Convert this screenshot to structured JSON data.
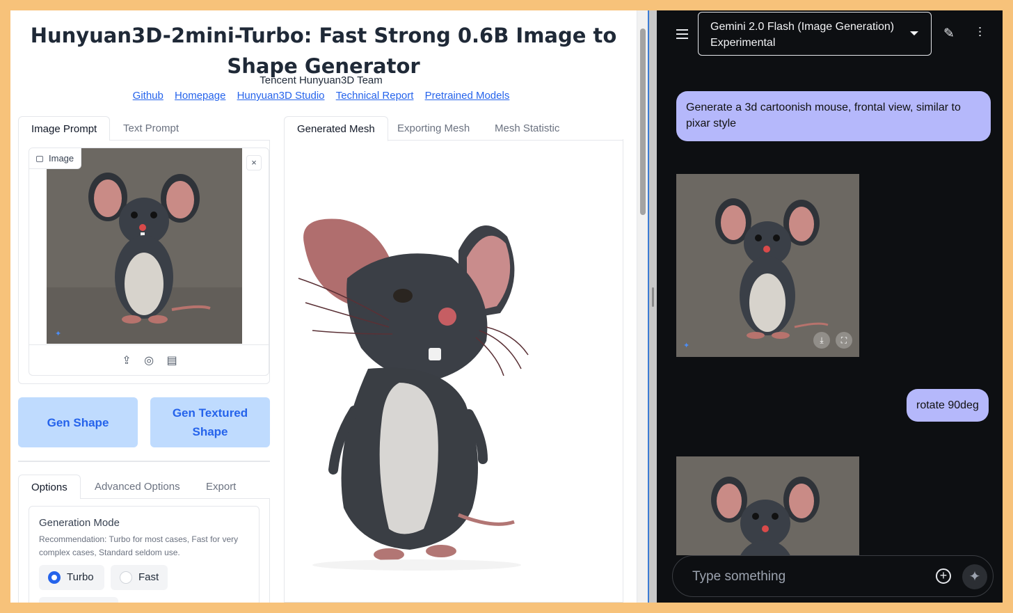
{
  "app": {
    "title": "Hunyuan3D-2mini-Turbo: Fast Strong 0.6B Image to Shape Generator",
    "team": "Tencent Hunyuan3D Team",
    "links": [
      "Github",
      "Homepage",
      "Hunyuan3D Studio",
      "Technical Report",
      "Pretrained Models"
    ]
  },
  "prompt_tabs": [
    "Image Prompt",
    "Text Prompt"
  ],
  "image_component": {
    "label": "Image",
    "close": "×"
  },
  "image_tools": [
    "upload-icon",
    "webcam-icon",
    "clipboard-icon"
  ],
  "buttons": {
    "gen_shape": "Gen Shape",
    "gen_textured_shape": "Gen Textured Shape"
  },
  "option_tabs": [
    "Options",
    "Advanced Options",
    "Export"
  ],
  "generation_mode": {
    "title": "Generation Mode",
    "info": "Recommendation: Turbo for most cases, Fast for very complex cases, Standard seldom use.",
    "options": [
      "Turbo",
      "Fast"
    ],
    "selected": "Turbo"
  },
  "output_tabs": [
    "Generated Mesh",
    "Exporting Mesh",
    "Mesh Statistic"
  ],
  "gemini": {
    "model": "Gemini 2.0 Flash (Image Generation) Experimental",
    "messages": [
      {
        "role": "user",
        "text": "Generate a 3d cartoonish mouse, frontal view, similar to pixar style"
      },
      {
        "role": "user",
        "text": "rotate 90deg"
      }
    ],
    "input_placeholder": "Type something",
    "icons": [
      "menu-icon",
      "edit-icon",
      "tune-icon",
      "download-icon",
      "fullscreen-icon",
      "add-icon",
      "sparkle-icon"
    ]
  }
}
